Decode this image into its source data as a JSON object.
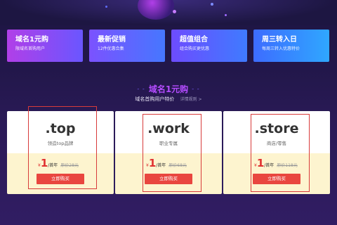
{
  "colors": {
    "background": "#22174a",
    "accent_title": "#b44cff",
    "buy_button": "#e9463f",
    "price": "#e03232",
    "card_lower": "#fdf4cf",
    "highlight_border": "#d83b3b"
  },
  "promos": [
    {
      "title": "域名1元购",
      "subtitle": "限域名首购用户",
      "gradient": [
        "#b13fe8",
        "#6a56ff"
      ]
    },
    {
      "title": "最新促销",
      "subtitle": "12件优惠合集",
      "gradient": [
        "#7b52ff",
        "#4677ff"
      ]
    },
    {
      "title": "超值组合",
      "subtitle": "组合购买更优惠",
      "gradient": [
        "#6d4cff",
        "#3f7bff"
      ]
    },
    {
      "title": "周三转入日",
      "subtitle": "每周三转入优惠特价",
      "gradient": [
        "#3d6cff",
        "#2fa7ff"
      ]
    }
  ],
  "section": {
    "title": "域名1元购",
    "subtitle": "域名首购用户特价",
    "more_link": "详情规则 >"
  },
  "cards": [
    {
      "name": ".top",
      "desc": "领造top品牌",
      "currency": "¥",
      "price": "1",
      "unit": "/首年",
      "original": "原价28元",
      "buy": "立即购买"
    },
    {
      "name": ".work",
      "desc": "职业专属",
      "currency": "¥",
      "price": "1",
      "unit": "/首年",
      "original": "原价68元",
      "buy": "立即购买"
    },
    {
      "name": ".store",
      "desc": "商店/零售",
      "currency": "¥",
      "price": "1",
      "unit": "/首年",
      "original": "原价118元",
      "buy": "立即购买"
    }
  ]
}
